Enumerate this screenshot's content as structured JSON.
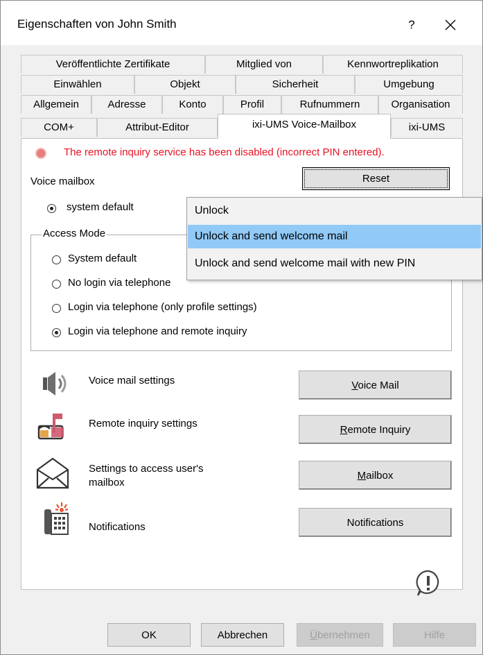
{
  "window": {
    "title": "Eigenschaften von John Smith",
    "help_label": "?"
  },
  "tabs": {
    "row1": [
      "Veröffentlichte Zertifikate",
      "Mitglied von",
      "Kennwortreplikation"
    ],
    "row2": [
      "Einwählen",
      "Objekt",
      "Sicherheit",
      "Umgebung"
    ],
    "row3": [
      "Allgemein",
      "Adresse",
      "Konto",
      "Profil",
      "Rufnummern",
      "Organisation"
    ],
    "row4": [
      "COM+",
      "Attribut-Editor",
      "ixi-UMS Voice-Mailbox",
      "ixi-UMS"
    ],
    "selected": "ixi-UMS Voice-Mailbox"
  },
  "status": {
    "message": "The remote inquiry service has been disabled (incorrect PIN entered).",
    "color": "#e81123"
  },
  "voice_mailbox": {
    "label": "Voice mailbox",
    "reset_label": "Reset",
    "system_default_label": "system default"
  },
  "access_mode": {
    "title": "Access Mode",
    "options": [
      {
        "label": "System default",
        "selected": false
      },
      {
        "label": "No login via telephone",
        "selected": false
      },
      {
        "label": "Login via telephone (only profile settings)",
        "selected": false
      },
      {
        "label": "Login via telephone and remote inquiry",
        "selected": true
      }
    ]
  },
  "settings": [
    {
      "icon": "speaker-icon",
      "label": "Voice mail settings",
      "button": "Voice Mail",
      "accel": "V",
      "rest": "oice Mail"
    },
    {
      "icon": "mailbox-icon",
      "label": "Remote inquiry settings",
      "button": "Remote Inquiry",
      "accel": "R",
      "rest": "emote Inquiry"
    },
    {
      "icon": "envelope-icon",
      "label": "Settings to access user's mailbox",
      "label1": "Settings to access user's",
      "label2": "mailbox",
      "button": "Mailbox",
      "accel": "M",
      "rest": "ailbox"
    },
    {
      "icon": "phone-notification-icon",
      "label": "Notifications",
      "button": "Notifications"
    }
  ],
  "dropdown_menu": {
    "items": [
      "Unlock",
      "Unlock and send welcome mail",
      "Unlock and send welcome mail with new PIN"
    ],
    "highlighted": "Unlock and send welcome mail",
    "highlight_color": "#91c9f7"
  },
  "footer": {
    "ok": "OK",
    "cancel": "Abbrechen",
    "apply_accel": "Ü",
    "apply_rest": "bernehmen",
    "help": "Hilfe"
  }
}
